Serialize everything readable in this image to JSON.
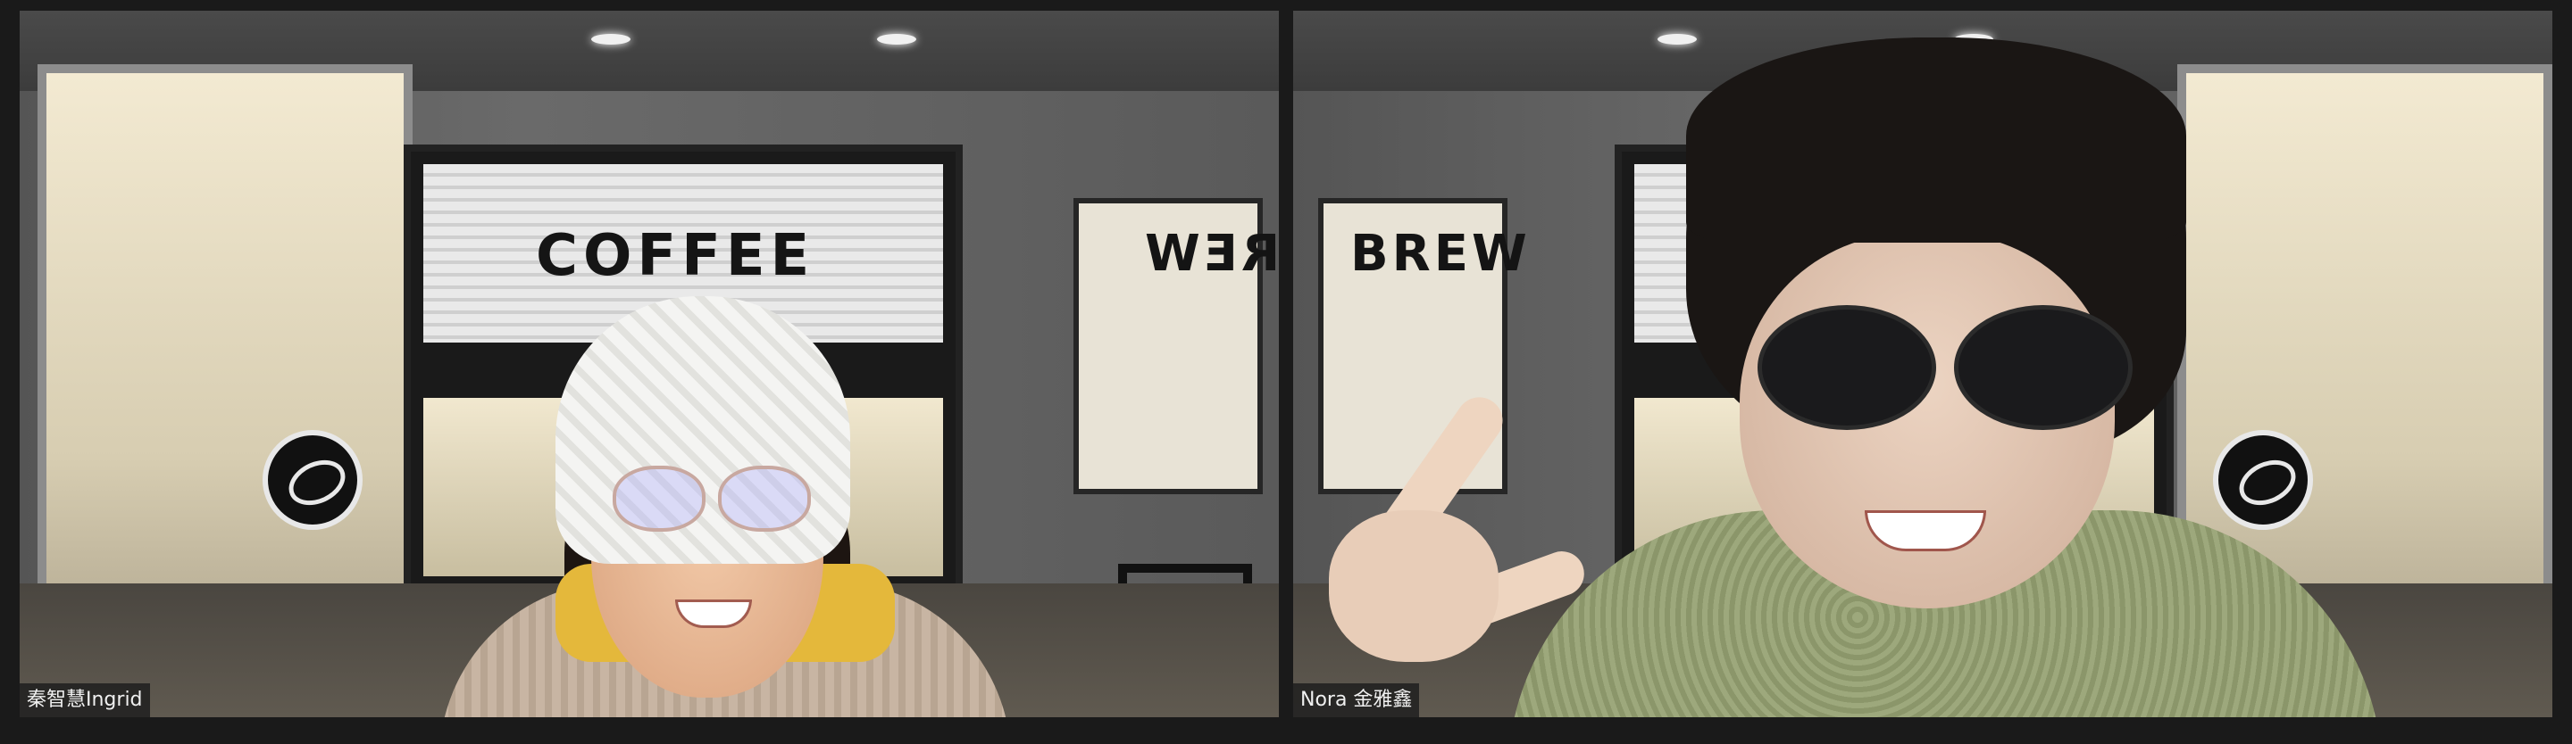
{
  "meeting": {
    "participants": [
      {
        "name": "秦智慧Ingrid",
        "background_sign": "COFFEE",
        "background_brand": "BREW"
      },
      {
        "name": "Nora 金雅鑫",
        "background_sign": "BREW",
        "background_brand": "BREW"
      }
    ]
  },
  "icons": {
    "brew_logo": "brew-logo-icon"
  },
  "colors": {
    "name_tag_bg": "#1e1e1e",
    "frame_bg": "#1a1a1a"
  }
}
